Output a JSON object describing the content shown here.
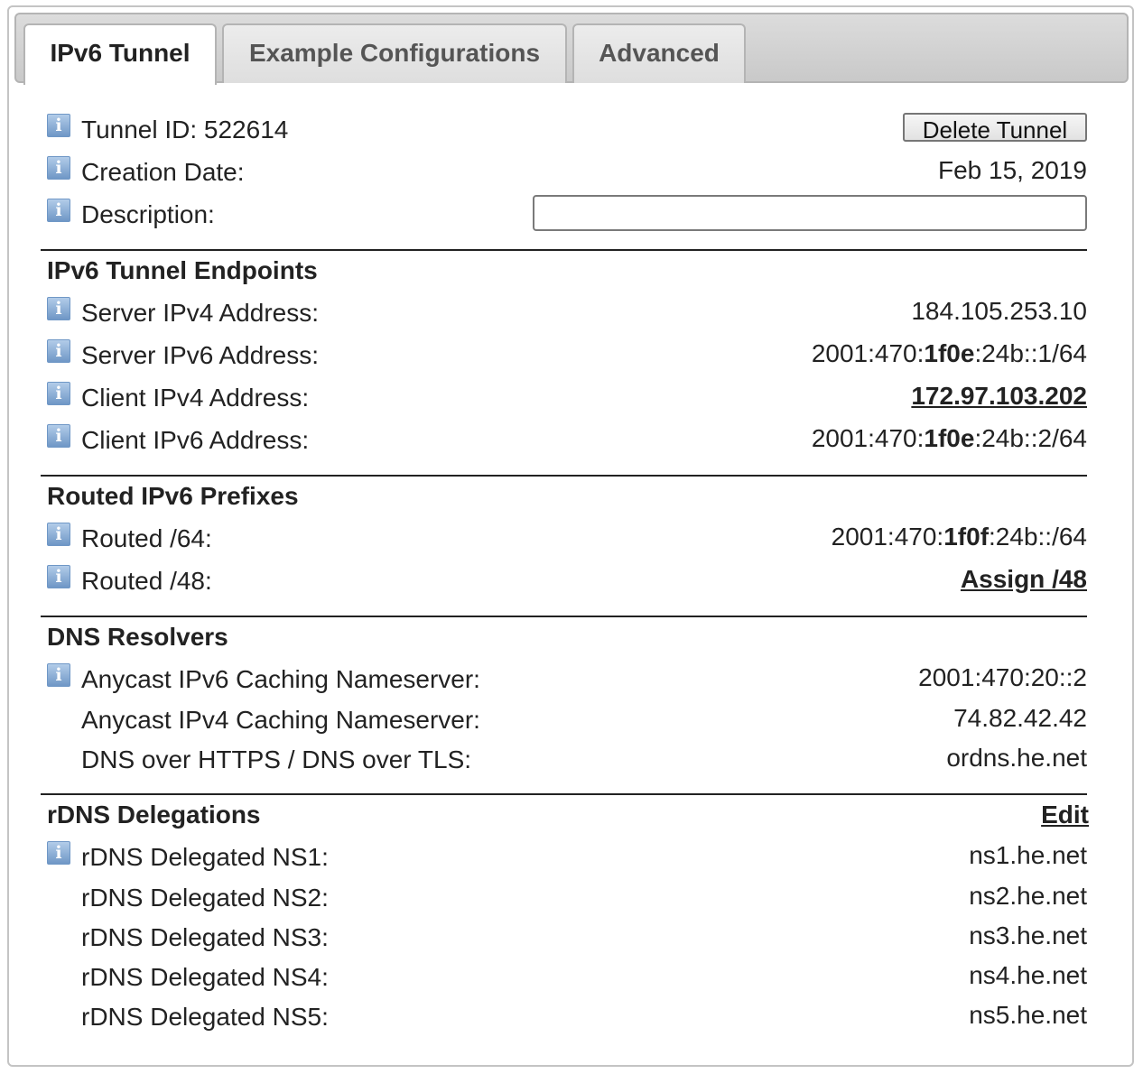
{
  "tabs": [
    {
      "label": "IPv6 Tunnel",
      "active": true
    },
    {
      "label": "Example Configurations",
      "active": false
    },
    {
      "label": "Advanced",
      "active": false
    }
  ],
  "tunnel": {
    "id_label": "Tunnel ID: 522614",
    "delete_button": "Delete Tunnel",
    "creation_label": "Creation Date:",
    "creation_value": "Feb 15, 2019",
    "description_label": "Description:",
    "description_value": ""
  },
  "endpoints": {
    "title": "IPv6 Tunnel Endpoints",
    "server_ipv4_label": "Server IPv4 Address:",
    "server_ipv4_value": "184.105.253.10",
    "server_ipv6_label": "Server IPv6 Address:",
    "server_ipv6": {
      "pre": "2001:470:",
      "bold": "1f0e",
      "post": ":24b::1/64"
    },
    "client_ipv4_label": "Client IPv4 Address:",
    "client_ipv4_value": "172.97.103.202",
    "client_ipv6_label": "Client IPv6 Address:",
    "client_ipv6": {
      "pre": "2001:470:",
      "bold": "1f0e",
      "post": ":24b::2/64"
    }
  },
  "routed": {
    "title": "Routed IPv6 Prefixes",
    "r64_label": "Routed /64:",
    "r64": {
      "pre": "2001:470:",
      "bold": "1f0f",
      "post": ":24b::/64"
    },
    "r48_label": "Routed /48:",
    "r48_link": "Assign /48"
  },
  "dns": {
    "title": "DNS Resolvers",
    "ipv6_label": "Anycast IPv6 Caching Nameserver:",
    "ipv6_value": "2001:470:20::2",
    "ipv4_label": "Anycast IPv4 Caching Nameserver:",
    "ipv4_value": "74.82.42.42",
    "doh_label": "DNS over HTTPS / DNS over TLS:",
    "doh_value": "ordns.he.net"
  },
  "rdns": {
    "title": "rDNS Delegations",
    "edit_link": "Edit",
    "items": [
      {
        "label": "rDNS Delegated NS1:",
        "value": "ns1.he.net"
      },
      {
        "label": "rDNS Delegated NS2:",
        "value": "ns2.he.net"
      },
      {
        "label": "rDNS Delegated NS3:",
        "value": "ns3.he.net"
      },
      {
        "label": "rDNS Delegated NS4:",
        "value": "ns4.he.net"
      },
      {
        "label": "rDNS Delegated NS5:",
        "value": "ns5.he.net"
      }
    ]
  },
  "icons": {
    "info": "info-icon",
    "glyph": "i"
  }
}
